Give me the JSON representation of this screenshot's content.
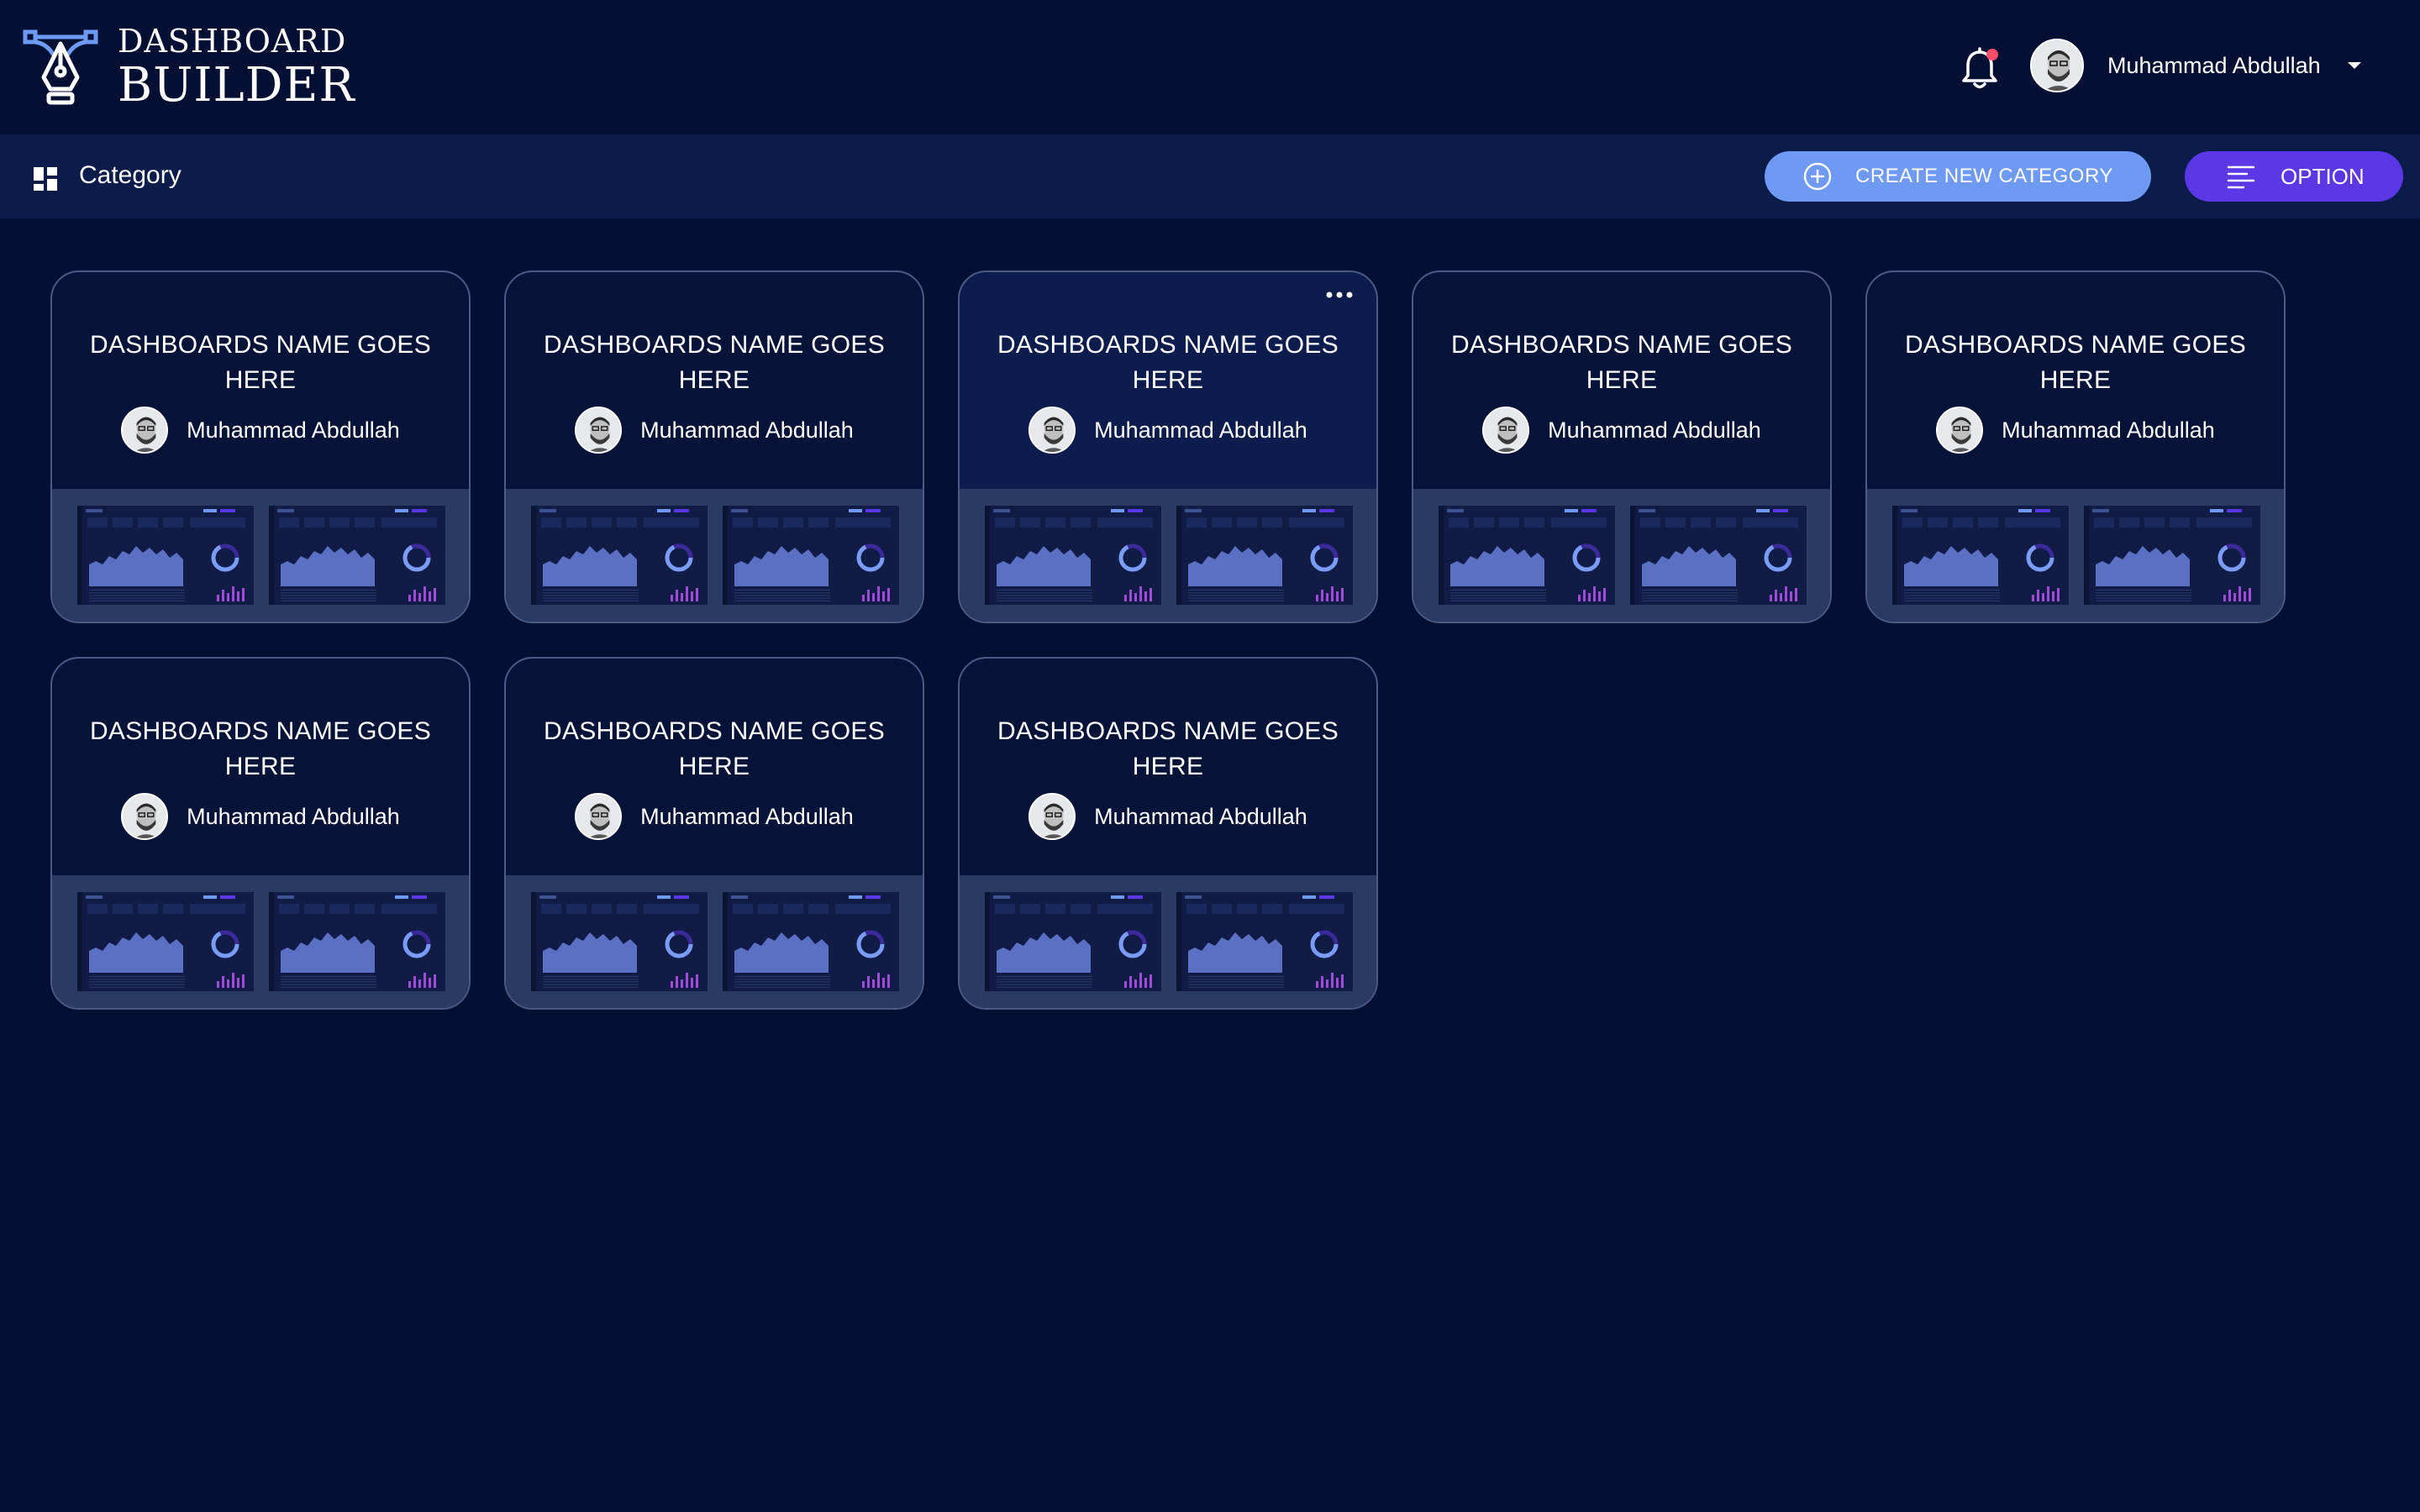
{
  "brand": {
    "line1": "DASHBOARD",
    "line2": "BUILDER"
  },
  "header": {
    "user_name": "Muhammad Abdullah",
    "notification_dot_color": "#ff4d6a"
  },
  "toolbar": {
    "title": "Category",
    "create_label": "CREATE NEW CATEGORY",
    "option_label": "OPTION"
  },
  "colors": {
    "background": "#041033",
    "toolbar": "#0b1c4b",
    "create_button": "#6f9af4",
    "option_button": "#5b38e6",
    "card_border": "#4b5b86",
    "card_preview_bg": "#2b3a62"
  },
  "cards": [
    {
      "title": "DASHBOARDS NAME GOES HERE",
      "author": "Muhammad Abdullah"
    },
    {
      "title": "DASHBOARDS NAME GOES HERE",
      "author": "Muhammad Abdullah"
    },
    {
      "title": "DASHBOARDS NAME GOES HERE",
      "author": "Muhammad Abdullah"
    },
    {
      "title": "DASHBOARDS NAME GOES HERE",
      "author": "Muhammad Abdullah"
    },
    {
      "title": "DASHBOARDS NAME GOES HERE",
      "author": "Muhammad Abdullah"
    },
    {
      "title": "DASHBOARDS NAME GOES HERE",
      "author": "Muhammad Abdullah"
    },
    {
      "title": "DASHBOARDS NAME GOES HERE",
      "author": "Muhammad Abdullah"
    },
    {
      "title": "DASHBOARDS NAME GOES HERE",
      "author": "Muhammad Abdullah"
    }
  ],
  "active_card_index": 2
}
